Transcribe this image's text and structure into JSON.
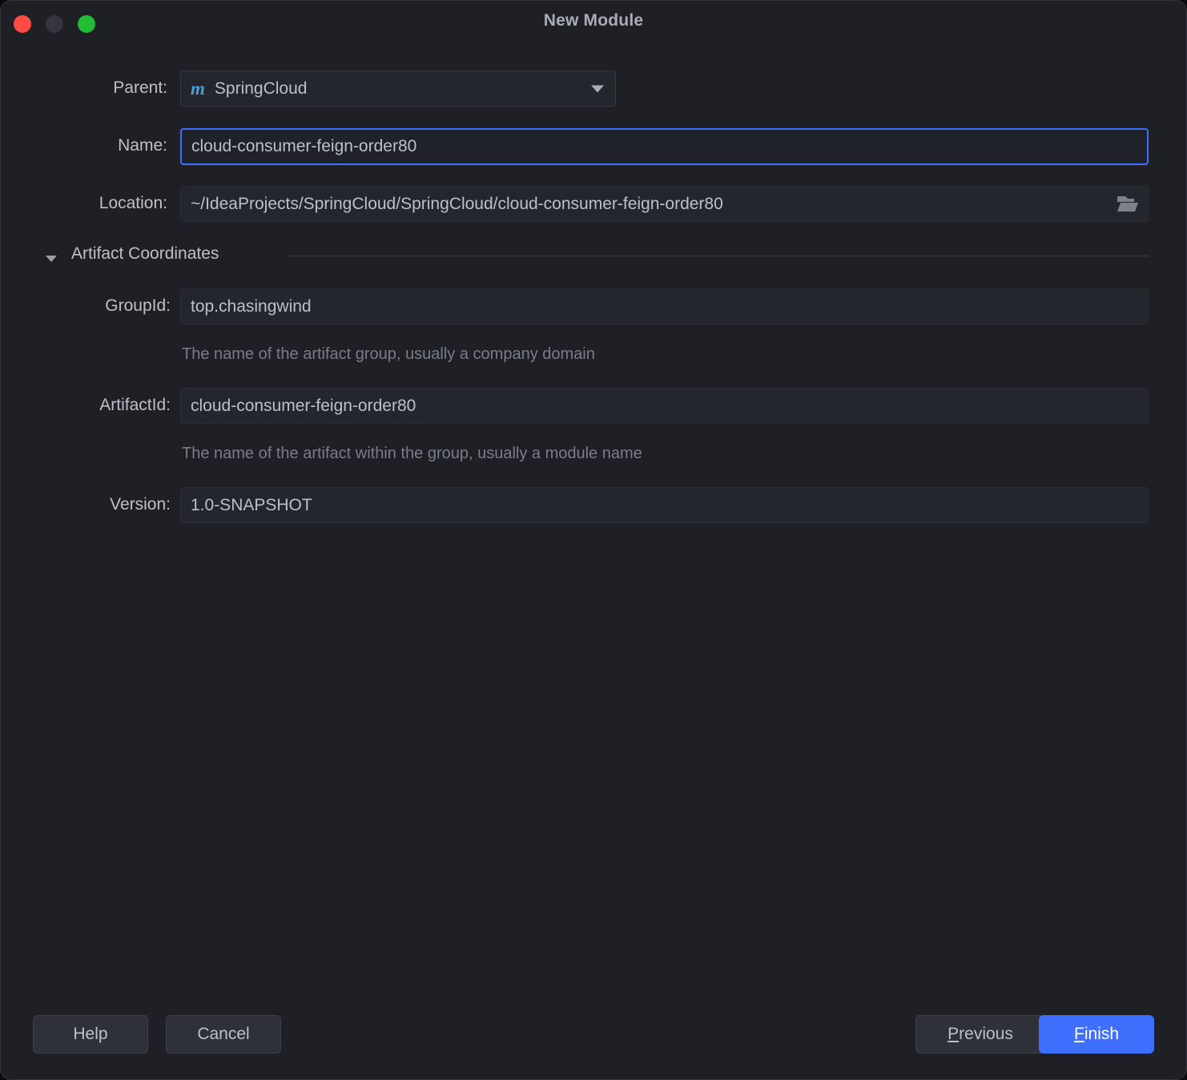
{
  "window": {
    "title": "New Module",
    "controls": [
      {
        "name": "close",
        "color": "#ff4b45"
      },
      {
        "name": "minimize",
        "color": "#33363d"
      },
      {
        "name": "zoom",
        "color": "#22bd35"
      }
    ],
    "background": "#1e2025"
  },
  "form": {
    "parent": {
      "label": "Parent:",
      "value": "SpringCloud",
      "icon": "maven-icon",
      "icon_glyph": "m",
      "icon_color": "#4a9fd4"
    },
    "name": {
      "label": "Name:",
      "value": "cloud-consumer-feign-order80",
      "focused": true,
      "focus_color": "#3f6fff"
    },
    "location": {
      "label": "Location:",
      "value": "~/IdeaProjects/SpringCloud/SpringCloud/cloud-consumer-feign-order80",
      "browse_icon": "folder-icon"
    },
    "artifact_coordinates": {
      "title": "Artifact Coordinates",
      "expanded": true,
      "toggle_icon": "chevron-down-icon",
      "group_id": {
        "label": "GroupId:",
        "value": "top.chasingwind",
        "hint": "The name of the artifact group, usually a company domain"
      },
      "artifact_id": {
        "label": "ArtifactId:",
        "value": "cloud-consumer-feign-order80",
        "hint": "The name of the artifact within the group, usually a module name"
      },
      "version": {
        "label": "Version:",
        "value": "1.0-SNAPSHOT"
      }
    }
  },
  "footer": {
    "help_label": "Help",
    "cancel_label": "Cancel",
    "previous_label_prefix": "",
    "previous_mnemonic": "P",
    "previous_label_rest": "revious",
    "finish_mnemonic": "F",
    "finish_label_rest": "inish",
    "primary_color": "#3f6fff"
  }
}
